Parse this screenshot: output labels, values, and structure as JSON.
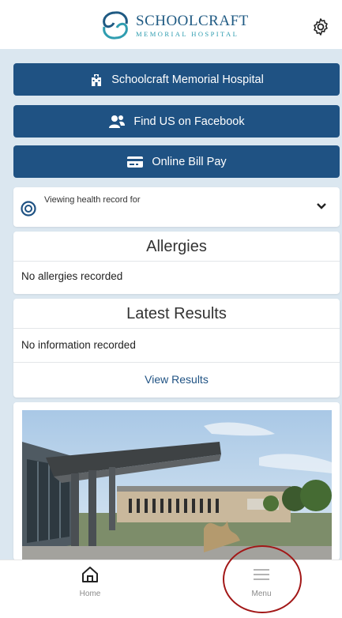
{
  "header": {
    "logo_name": "SCHOOLCRAFT",
    "logo_sub": "MEMORIAL HOSPITAL",
    "settings_icon": "gear-icon"
  },
  "buttons": [
    {
      "label": "Schoolcraft Memorial Hospital",
      "icon": "hospital-icon"
    },
    {
      "label": "Find US on Facebook",
      "icon": "people-icon"
    },
    {
      "label": "Online Bill Pay",
      "icon": "credit-card-icon"
    }
  ],
  "viewing": {
    "label": "Viewing health record for",
    "icon": "person-circle-icon",
    "chevron": "chevron-down-icon"
  },
  "allergies": {
    "title": "Allergies",
    "text": "No allergies recorded"
  },
  "results": {
    "title": "Latest Results",
    "text": "No information recorded",
    "link": "View Results"
  },
  "nav": {
    "home_label": "Home",
    "menu_label": "Menu"
  },
  "colors": {
    "brand": "#1f5283",
    "background": "#dbe7f0",
    "annotation": "#a21717"
  }
}
